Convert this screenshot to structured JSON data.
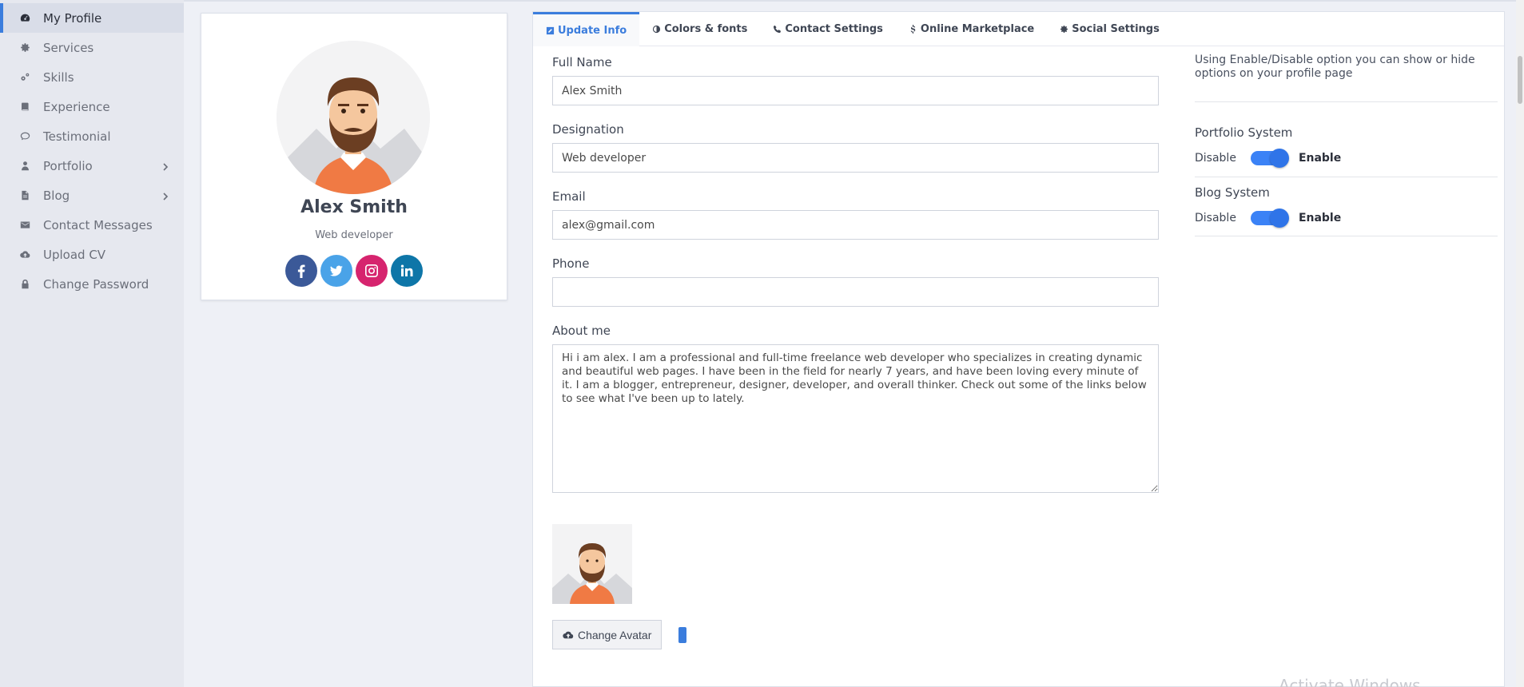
{
  "sidebar": {
    "items": [
      {
        "label": "My Profile",
        "icon": "dashboard-icon"
      },
      {
        "label": "Services",
        "icon": "gear-icon"
      },
      {
        "label": "Skills",
        "icon": "gears-icon"
      },
      {
        "label": "Experience",
        "icon": "book-icon"
      },
      {
        "label": "Testimonial",
        "icon": "comment-icon"
      },
      {
        "label": "Portfolio",
        "icon": "user-icon"
      },
      {
        "label": "Blog",
        "icon": "file-icon"
      },
      {
        "label": "Contact Messages",
        "icon": "envelope-icon"
      },
      {
        "label": "Upload CV",
        "icon": "cloud-upload-icon"
      },
      {
        "label": "Change Password",
        "icon": "lock-icon"
      }
    ]
  },
  "profile": {
    "name": "Alex Smith",
    "role": "Web developer"
  },
  "tabs": [
    {
      "label": "Update Info"
    },
    {
      "label": "Colors & fonts"
    },
    {
      "label": "Contact Settings"
    },
    {
      "label": "Online Marketplace"
    },
    {
      "label": "Social Settings"
    }
  ],
  "form": {
    "full_name_label": "Full Name",
    "full_name_value": "Alex Smith",
    "designation_label": "Designation",
    "designation_value": "Web developer",
    "email_label": "Email",
    "email_value": "alex@gmail.com",
    "phone_label": "Phone",
    "phone_value": "",
    "about_label": "About me",
    "about_value": "Hi i am alex. I am a professional and full-time freelance web developer who specializes in creating dynamic and beautiful web pages. I have been in the field for nearly 7 years, and have been loving every minute of it. I am a blogger, entrepreneur, designer, developer, and overall thinker. Check out some of the links below to see what I've been up to lately.",
    "change_avatar_label": "Change Avatar"
  },
  "settings": {
    "info": "Using Enable/Disable option you can show or hide options on your profile page",
    "portfolio_label": "Portfolio System",
    "blog_label": "Blog System",
    "disable_label": "Disable",
    "enable_label": "Enable"
  },
  "watermark": "Activate Windows",
  "colors": {
    "accent": "#3b7ddd",
    "toggle": "#3b82f6",
    "facebook": "#3b5998",
    "twitter": "#4aa3e8",
    "instagram": "#d6246e",
    "linkedin": "#0e76a8"
  }
}
